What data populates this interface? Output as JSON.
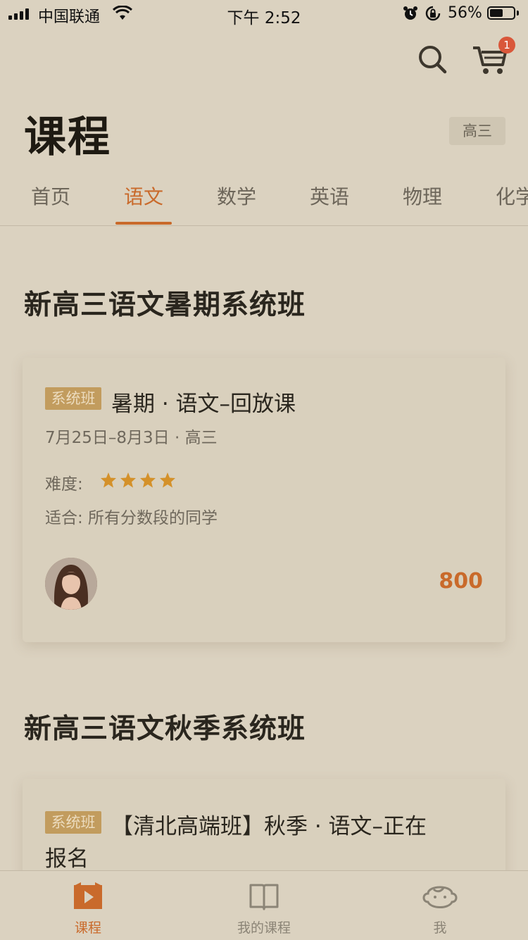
{
  "status_bar": {
    "carrier": "中国联通",
    "time": "下午 2:52",
    "battery_percent": "56%",
    "battery_level": 0.56
  },
  "header": {
    "title": "课程",
    "grade_selector": "高三",
    "cart_count": "1",
    "search_icon": "search-icon",
    "cart_icon": "cart-icon"
  },
  "tabs": [
    {
      "label": "首页",
      "active": false
    },
    {
      "label": "语文",
      "active": true
    },
    {
      "label": "数学",
      "active": false
    },
    {
      "label": "英语",
      "active": false
    },
    {
      "label": "物理",
      "active": false
    },
    {
      "label": "化学",
      "active": false
    }
  ],
  "sections": [
    {
      "title": "新高三语文暑期系统班",
      "card": {
        "tag": "系统班",
        "name": "暑期 · 语文–回放课",
        "schedule": "7月25日–8月3日 · 高三",
        "difficulty_label": "难度:",
        "difficulty_stars": 4,
        "suitable": "适合:  所有分数段的同学",
        "price": "800"
      }
    },
    {
      "title": "新高三语文秋季系统班",
      "card": {
        "tag": "系统班",
        "name_line1": "【清北高端班】秋季 · 语文–正在",
        "name_line2": "报名"
      }
    }
  ],
  "tabbar": [
    {
      "label": "课程",
      "icon": "play-video-icon",
      "active": true
    },
    {
      "label": "我的课程",
      "icon": "open-book-icon",
      "active": false
    },
    {
      "label": "我",
      "icon": "profile-face-icon",
      "active": false
    }
  ],
  "colors": {
    "accent": "#c96a2b",
    "background": "#dbd2c0",
    "tag": "#c29c5e",
    "star": "#d4912a",
    "badge": "#d9573a"
  }
}
